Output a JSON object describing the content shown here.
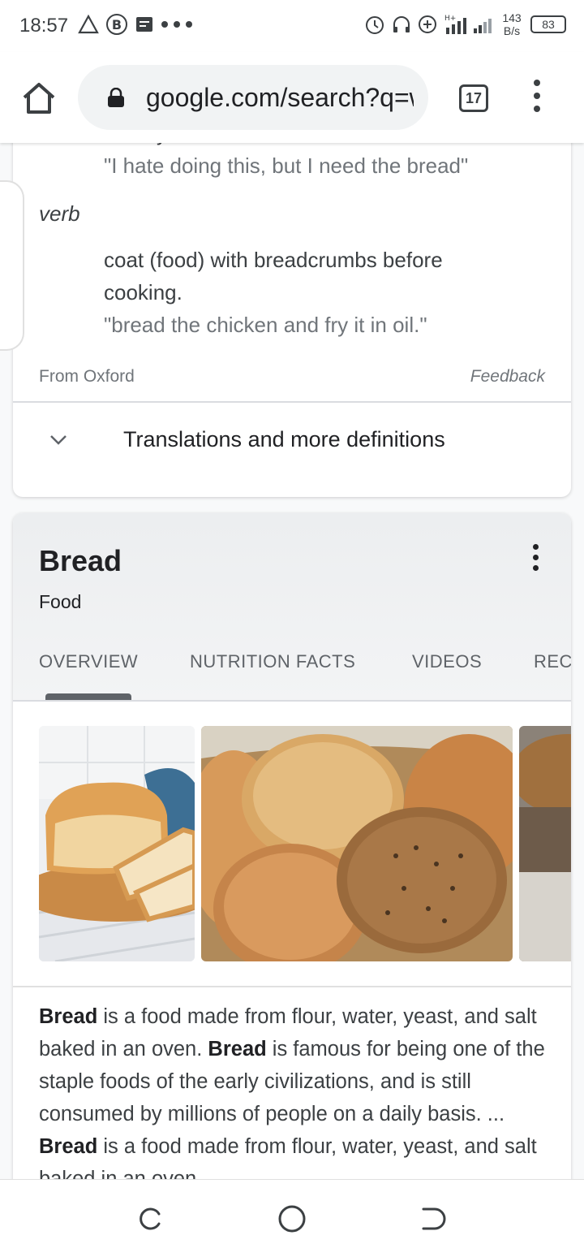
{
  "status_bar": {
    "time": "18:57",
    "speed_value": "143",
    "speed_unit": "B/s",
    "battery": "83"
  },
  "browser": {
    "url": "google.com/search?q=w",
    "tab_count": "17"
  },
  "dictionary": {
    "prev_definition_tail": "money.",
    "prev_example": "\"I hate doing this, but I need the bread\"",
    "part_of_speech": "verb",
    "verb_definition_line1": "coat (food) with breadcrumbs before",
    "verb_definition_line2": "cooking.",
    "verb_example": "\"bread the chicken and fry it in oil.\"",
    "source": "From Oxford",
    "feedback": "Feedback",
    "translations_label": "Translations and more definitions"
  },
  "knowledge_panel": {
    "title": "Bread",
    "subtitle": "Food",
    "tabs": [
      "OVERVIEW",
      "NUTRITION FACTS",
      "VIDEOS",
      "REC"
    ],
    "active_tab": "OVERVIEW",
    "description": {
      "b1": "Bread",
      "t1": " is a food made from flour, water, yeast, and salt baked in an oven. ",
      "b2": "Bread",
      "t2": " is famous for being one of the staple foods of the early civilizations, and is still consumed by millions of people on a daily basis. ... ",
      "b3": "Bread",
      "t3": " is a food made from flour, water, yeast, and salt baked in an oven."
    }
  },
  "icons": {
    "home": "home-icon",
    "lock": "lock-icon",
    "menu": "more-vert-icon",
    "chevron": "chevron-down-icon"
  },
  "colors": {
    "background": "#f8f9fa",
    "panel_header": "#eceef0",
    "text_primary": "#202124",
    "text_secondary": "#70757a"
  }
}
